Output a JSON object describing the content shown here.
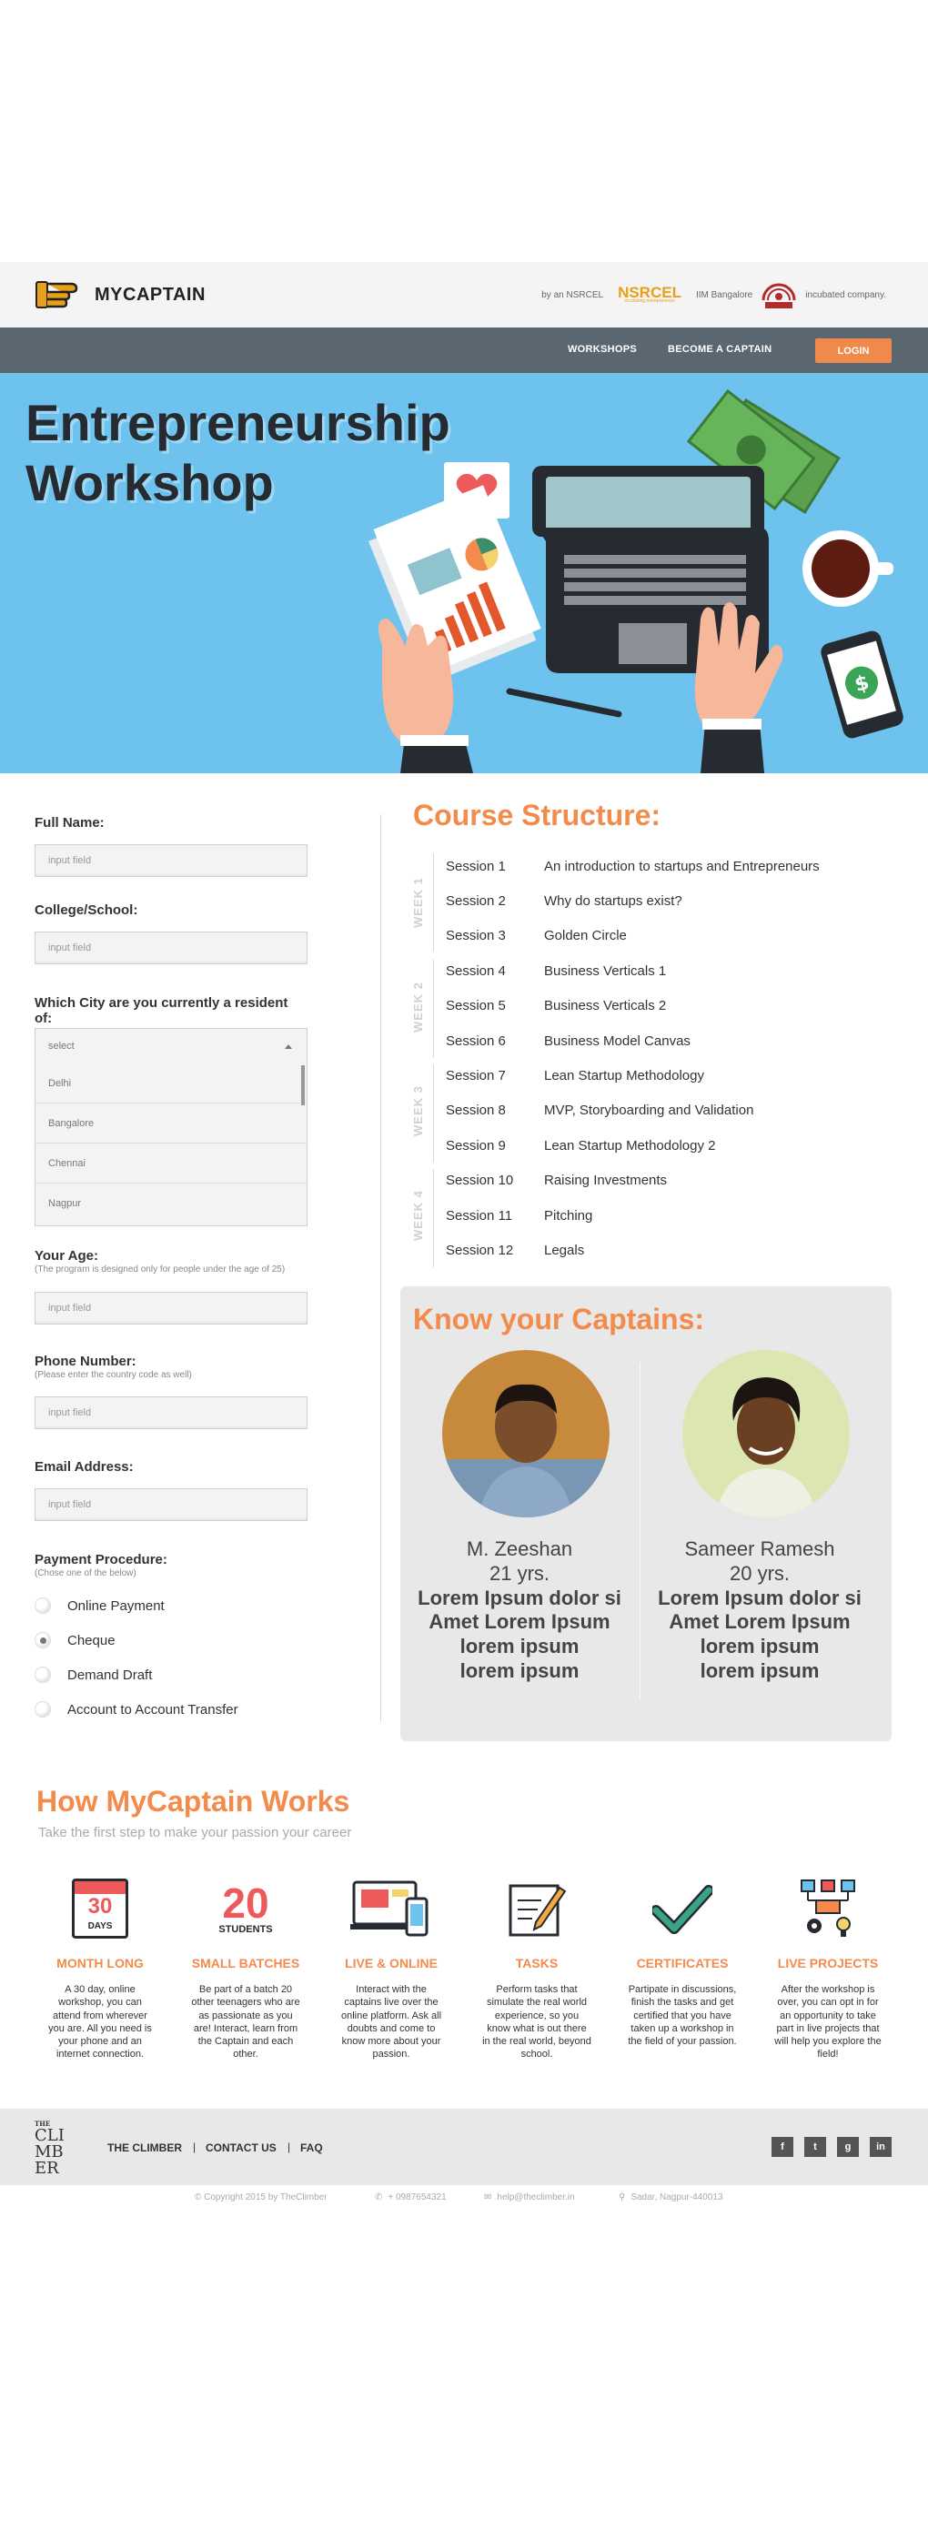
{
  "header": {
    "brand": "MYCAPTAIN",
    "incubated_prefix": "by an NSRCEL",
    "nsrcel_logo": "NSRCEL",
    "nsrcel_tagline": "incubating entrepreneurs",
    "iim_label": "IIM Bangalore",
    "incubated_suffix": "incubated company."
  },
  "nav": {
    "workshops": "WORKSHOPS",
    "become_captain": "BECOME A CAPTAIN",
    "login": "LOGIN"
  },
  "hero": {
    "title_line1": "Entrepreneurship",
    "title_line2": "Workshop"
  },
  "form": {
    "full_name_label": "Full Name:",
    "full_name_placeholder": "input field",
    "college_label": "College/School:",
    "college_placeholder": "input field",
    "city_label": "Which City are you currently a resident of:",
    "city_select": "select",
    "city_options": [
      "Delhi",
      "Bangalore",
      "Chennai",
      "Nagpur"
    ],
    "age_label": "Your Age:",
    "age_hint": "(The program is designed only for people under the age of 25)",
    "age_placeholder": "input field",
    "phone_label": "Phone Number:",
    "phone_hint": "(Please enter the country code as well)",
    "phone_placeholder": "input field",
    "email_label": "Email Address:",
    "email_placeholder": "input field",
    "payment_label": "Payment Procedure:",
    "payment_hint": "(Chose one of the below)",
    "payment_options": [
      "Online Payment",
      "Cheque",
      "Demand Draft",
      "Account to Account Transfer"
    ],
    "payment_selected": "Cheque"
  },
  "course": {
    "title": "Course Structure:",
    "weeks": [
      "WEEK 1",
      "WEEK 2",
      "WEEK 3",
      "WEEK 4"
    ],
    "sessions": [
      {
        "num": "Session 1",
        "title": "An introduction to startups and Entrepreneurs"
      },
      {
        "num": "Session 2",
        "title": "Why do startups exist?"
      },
      {
        "num": "Session 3",
        "title": "Golden Circle"
      },
      {
        "num": "Session 4",
        "title": "Business Verticals 1"
      },
      {
        "num": "Session 5",
        "title": "Business Verticals 2"
      },
      {
        "num": "Session 6",
        "title": "Business Model Canvas"
      },
      {
        "num": "Session 7",
        "title": "Lean Startup Methodology"
      },
      {
        "num": "Session 8",
        "title": "MVP, Storyboarding and Validation"
      },
      {
        "num": "Session 9",
        "title": "Lean Startup Methodology 2"
      },
      {
        "num": "Session 10",
        "title": "Raising Investments"
      },
      {
        "num": "Session 11",
        "title": "Pitching"
      },
      {
        "num": "Session 12",
        "title": "Legals"
      }
    ]
  },
  "captains": {
    "title": "Know your Captains:",
    "people": [
      {
        "name": "M. Zeeshan",
        "age": "21 yrs.",
        "bio1": "Lorem Ipsum dolor si",
        "bio2": "Amet Lorem Ipsum",
        "bio3": "lorem ipsum",
        "bio4": "lorem ipsum"
      },
      {
        "name": "Sameer Ramesh",
        "age": "20 yrs.",
        "bio1": "Lorem Ipsum dolor si",
        "bio2": "Amet Lorem Ipsum",
        "bio3": "lorem ipsum",
        "bio4": "lorem ipsum"
      }
    ]
  },
  "how": {
    "title": "How MyCaptain Works",
    "subtitle": "Take the first step to make your passion your career",
    "calendar_number": "30",
    "calendar_unit": "DAYS",
    "students_number": "20",
    "students_label": "STUDENTS",
    "features": [
      {
        "title": "MONTH LONG",
        "desc": "A 30 day, online workshop, you can attend from wherever you are. All you need is your phone and an internet connection."
      },
      {
        "title": "SMALL BATCHES",
        "desc": "Be part of a batch 20 other teenagers who are as passionate as you are! Interact, learn from the Captain and each other."
      },
      {
        "title": "LIVE & ONLINE",
        "desc": "Interact with the captains live over the online platform. Ask all doubts and come to know more about your passion."
      },
      {
        "title": "TASKS",
        "desc": "Perform tasks that simulate the real world experience, so you know what is out there in the real world, beyond school."
      },
      {
        "title": "CERTIFICATES",
        "desc": "Partipate in discussions, finish the tasks and get certified that you have taken up a workshop in the field of your passion."
      },
      {
        "title": "LIVE PROJECTS",
        "desc": "After the workshop is over, you can opt in for an opportunity to take part in live projects that will help you explore the field!"
      }
    ]
  },
  "footer": {
    "climber_small": "THE",
    "climber_logo": "CLIMBER",
    "links": [
      "THE CLIMBER",
      "CONTACT US",
      "FAQ"
    ],
    "separator": "|",
    "social": [
      "f",
      "t",
      "g",
      "in"
    ],
    "copyright": "© Copyright 2015 by TheClimber",
    "phone": "+ 0987654321",
    "email": "help@theclimber.in",
    "address": "Sadar, Nagpur-440013"
  },
  "colors": {
    "accent": "#f28b4b",
    "nav": "#5b6770",
    "hero": "#6ec3ee"
  }
}
